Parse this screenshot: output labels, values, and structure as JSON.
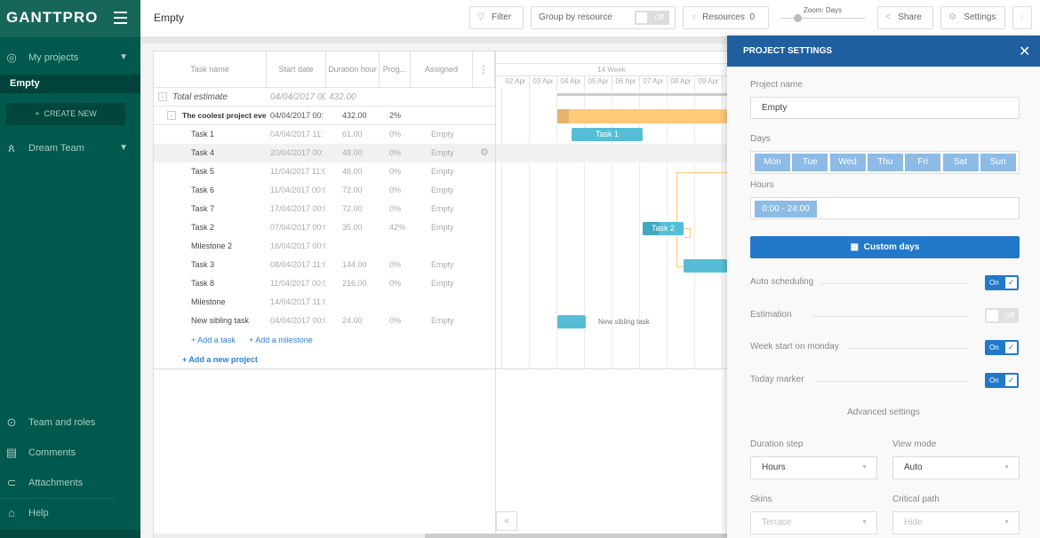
{
  "app": {
    "logo": "GANTTPRO",
    "project_title": "Empty"
  },
  "sidebar": {
    "my_projects": "My projects",
    "current_project": "Empty",
    "create_new": "CREATE NEW",
    "team": "Dream Team",
    "bottom": [
      {
        "label": "Team and roles",
        "icon": "key-icon"
      },
      {
        "label": "Comments",
        "icon": "comment-icon"
      },
      {
        "label": "Attachments",
        "icon": "paperclip-icon"
      },
      {
        "label": "Help",
        "icon": "graduation-cap-icon"
      }
    ]
  },
  "toolbar": {
    "filter": "Filter",
    "group_by": "Group by resource",
    "group_toggle": "Off",
    "resources": "Resources",
    "resources_count": "0",
    "zoom": "Zoom: Days",
    "zoom_level": 0.1,
    "share": "Share",
    "settings": "Settings"
  },
  "grid": {
    "headers": [
      "Task name",
      "Start date",
      "Duration hour",
      "Prog...",
      "Assigned"
    ],
    "rows": [
      {
        "name": "Total estimate",
        "start": "04/04/2017 00:",
        "dur": "432.00",
        "prog": "",
        "assigned": ""
      },
      {
        "name": "The coolest project ever",
        "start": "04/04/2017 00:",
        "dur": "432.00",
        "prog": "2%",
        "assigned": ""
      },
      {
        "name": "Task 1",
        "start": "04/04/2017 11:",
        "dur": "61.00",
        "prog": "0%",
        "assigned": "Empty"
      },
      {
        "name": "Task 4",
        "start": "20/04/2017 00:",
        "dur": "48.00",
        "prog": "0%",
        "assigned": "Empty"
      },
      {
        "name": "Task 5",
        "start": "11/04/2017 11:0",
        "dur": "48.00",
        "prog": "0%",
        "assigned": "Empty"
      },
      {
        "name": "Task 6",
        "start": "11/04/2017 00:0",
        "dur": "72.00",
        "prog": "0%",
        "assigned": "Empty"
      },
      {
        "name": "Task 7",
        "start": "17/04/2017 00:0",
        "dur": "72.00",
        "prog": "0%",
        "assigned": "Empty"
      },
      {
        "name": "Task 2",
        "start": "07/04/2017 00:0",
        "dur": "35.00",
        "prog": "42%",
        "assigned": "Empty"
      },
      {
        "name": "Milestone 2",
        "start": "16/04/2017 00:0",
        "dur": "",
        "prog": "",
        "assigned": ""
      },
      {
        "name": "Task 3",
        "start": "08/04/2017 11:0",
        "dur": "144.00",
        "prog": "0%",
        "assigned": "Empty"
      },
      {
        "name": "Task 8",
        "start": "11/04/2017 00:0",
        "dur": "216.00",
        "prog": "0%",
        "assigned": "Empty"
      },
      {
        "name": "Milestone",
        "start": "14/04/2017 11:0",
        "dur": "",
        "prog": "",
        "assigned": ""
      },
      {
        "name": "New sibling task",
        "start": "04/04/2017 00:0",
        "dur": "24.00",
        "prog": "0%",
        "assigned": "Empty"
      }
    ],
    "add_task": "+ Add a task",
    "add_milestone": "+ Add a milestone",
    "add_project": "+ Add a new project"
  },
  "timeline": {
    "week": "14 Week",
    "days": [
      "02 Apr",
      "03 Apr",
      "04 Apr",
      "05 Apr",
      "06 Apr",
      "07 Apr",
      "08 Apr",
      "09 Apr"
    ],
    "bar_task1": "Task 1",
    "bar_task2": "Task 2",
    "bar_sibling": "New sibling task"
  },
  "settings": {
    "title": "PROJECT SETTINGS",
    "project_name_label": "Project name",
    "project_name": "Empty",
    "days_label": "Days",
    "days": [
      "Mon",
      "Tue",
      "Wed",
      "Thu",
      "Fri",
      "Sat",
      "Sun"
    ],
    "hours_label": "Hours",
    "hours": "0:00 - 24:00",
    "custom_days": "Custom days",
    "toggles": [
      {
        "label": "Auto scheduling",
        "state": "On"
      },
      {
        "label": "Estimation",
        "state": "Off"
      },
      {
        "label": "Week start on monday",
        "state": "On"
      },
      {
        "label": "Today marker",
        "state": "On"
      }
    ],
    "advanced": "Advanced settings",
    "duration_step_label": "Duration step",
    "duration_step": "Hours",
    "view_mode_label": "View mode",
    "view_mode": "Auto",
    "skins_label": "Skins",
    "skins": "Terrace",
    "critical_label": "Critical path",
    "critical": "Hide"
  },
  "colors": {
    "sidebar": "#00594c",
    "accent": "#2278c9",
    "header": "#1f5f9f",
    "bar": "#55bed6",
    "project_bar": "#ffc97a"
  }
}
